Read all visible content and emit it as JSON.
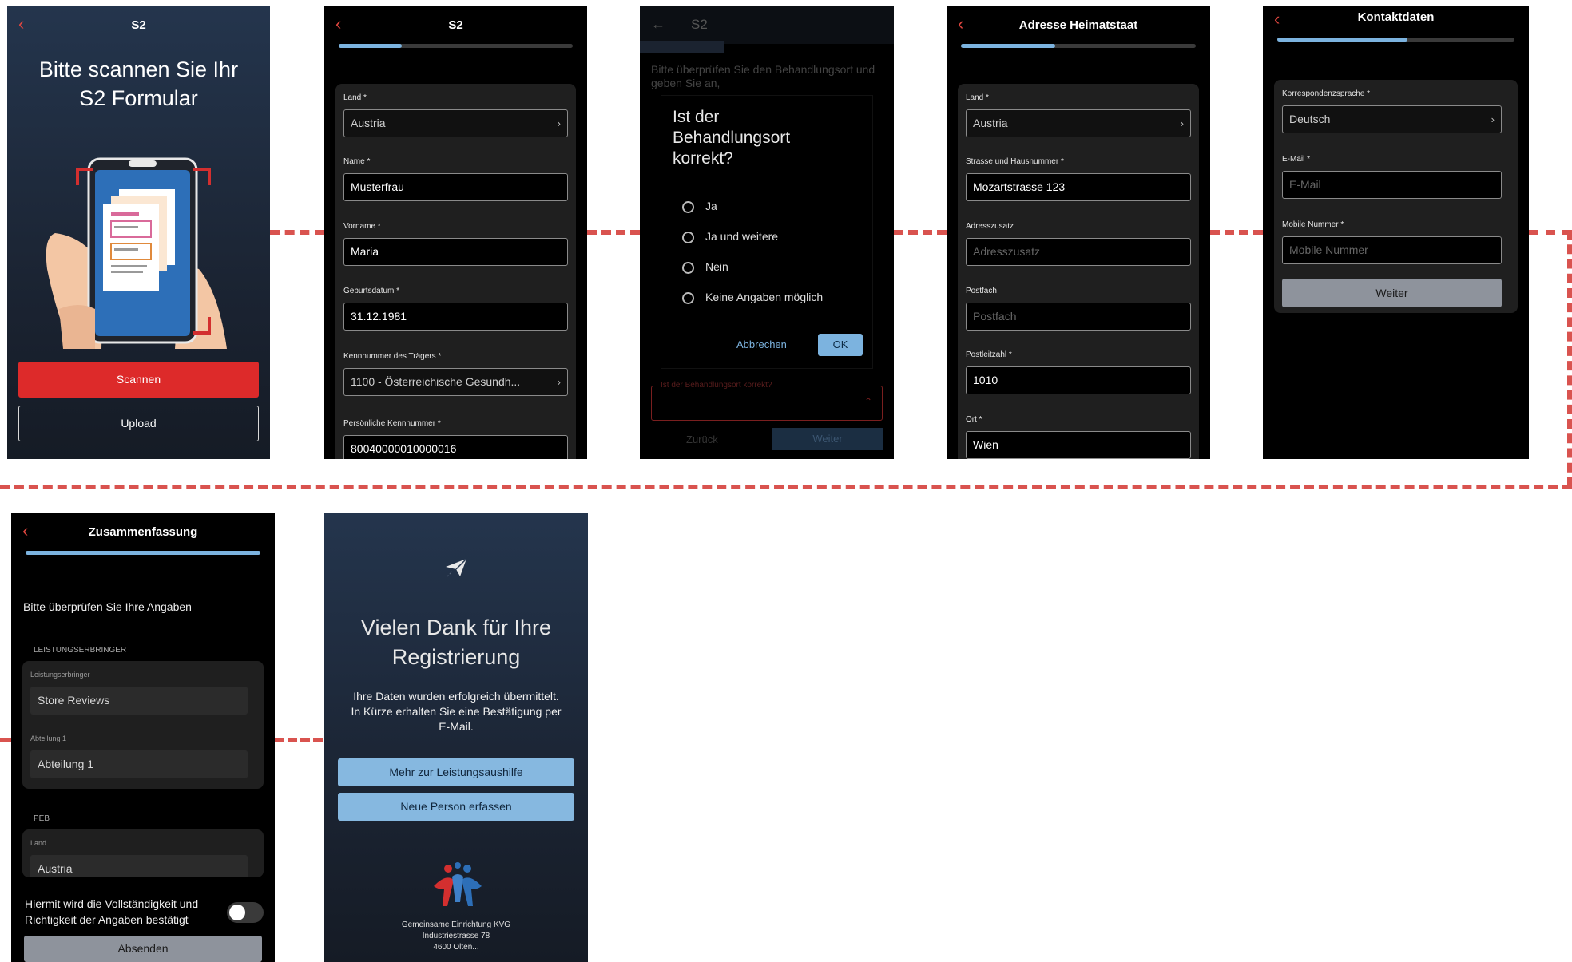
{
  "screen1": {
    "title": "S2",
    "back_icon": "chevron-left-icon",
    "heading_line1": "Bitte scannen Sie Ihr",
    "heading_line2": "S2 Formular",
    "scan_button": "Scannen",
    "upload_button": "Upload",
    "accent": "#dd2a2a"
  },
  "screen2": {
    "title": "S2",
    "progress": 0.27,
    "fields": [
      {
        "label": "Land *",
        "value": "Austria",
        "type": "select"
      },
      {
        "label": "Name *",
        "value": "Musterfrau",
        "type": "text"
      },
      {
        "label": "Vorname *",
        "value": "Maria",
        "type": "text"
      },
      {
        "label": "Geburtsdatum *",
        "value": "31.12.1981",
        "type": "text"
      },
      {
        "label": "Kennnummer des Trägers *",
        "value": "1100 - Österreichische Gesundh...",
        "type": "select"
      },
      {
        "label": "Persönliche Kennnummer *",
        "value": "80040000010000016",
        "type": "text"
      }
    ]
  },
  "screen3": {
    "title": "S2",
    "intro": "Bitte überprüfen Sie den Behandlungsort und geben Sie an,",
    "dialog": {
      "title": "Ist der Behandlungsort korrekt?",
      "options": [
        "Ja",
        "Ja und weitere",
        "Nein",
        "Keine Angaben möglich"
      ],
      "cancel": "Abbrechen",
      "ok": "OK"
    },
    "field_label": "Ist der Behandlungsort korrekt?",
    "back_button": "Zurück",
    "next_button": "Weiter"
  },
  "screen4": {
    "title": "Adresse Heimatstaat",
    "progress": 0.4,
    "fields": [
      {
        "label": "Land *",
        "value": "Austria",
        "type": "select"
      },
      {
        "label": "Strasse und Hausnummer *",
        "value": "Mozartstrasse 123",
        "type": "text"
      },
      {
        "label": "Adresszusatz",
        "value": "Adresszusatz",
        "type": "placeholder"
      },
      {
        "label": "Postfach",
        "value": "Postfach",
        "type": "placeholder"
      },
      {
        "label": "Postleitzahl *",
        "value": "1010",
        "type": "text"
      },
      {
        "label": "Ort *",
        "value": "Wien",
        "type": "text"
      }
    ]
  },
  "screen5": {
    "title": "Kontaktdaten",
    "progress": 0.55,
    "fields": [
      {
        "label": "Korrespondenzsprache *",
        "value": "Deutsch",
        "type": "select"
      },
      {
        "label": "E-Mail *",
        "value": "E-Mail",
        "type": "placeholder"
      },
      {
        "label": "Mobile Nummer *",
        "value": "Mobile Nummer",
        "type": "placeholder"
      }
    ],
    "next_button": "Weiter"
  },
  "screen6": {
    "title": "Zusammenfassung",
    "progress": 1.0,
    "intro": "Bitte überprüfen Sie Ihre Angaben",
    "section1": "LEISTUNGSERBRINGER",
    "section1_fields": [
      {
        "label": "Leistungserbringer",
        "value": "Store Reviews"
      },
      {
        "label": "Abteilung 1",
        "value": "Abteilung 1"
      }
    ],
    "section2": "PEB",
    "section2_fields": [
      {
        "label": "Land",
        "value": "Austria"
      }
    ],
    "confirm_text_line1": "Hiermit wird die Vollständigkeit und",
    "confirm_text_line2": "Richtigkeit der Angaben bestätigt",
    "submit_button": "Absenden"
  },
  "screen7": {
    "send_icon": "paper-plane-icon",
    "heading_line1": "Vielen Dank für Ihre",
    "heading_line2": "Registrierung",
    "message_line1": "Ihre Daten wurden erfolgreich übermittelt.",
    "message_line2": "In Kürze erhalten Sie eine Bestätigung per",
    "message_line3": "E-Mail.",
    "more_button": "Mehr zur Leistungsaushilfe",
    "new_person_button": "Neue Person erfassen",
    "logo_icon": "people-logo-icon",
    "footer_line1": "Gemeinsame Einrichtung KVG",
    "footer_line2": "Industriestrasse 78",
    "footer_line3": "4600 Olten...",
    "button_color": "#86b8e0"
  }
}
